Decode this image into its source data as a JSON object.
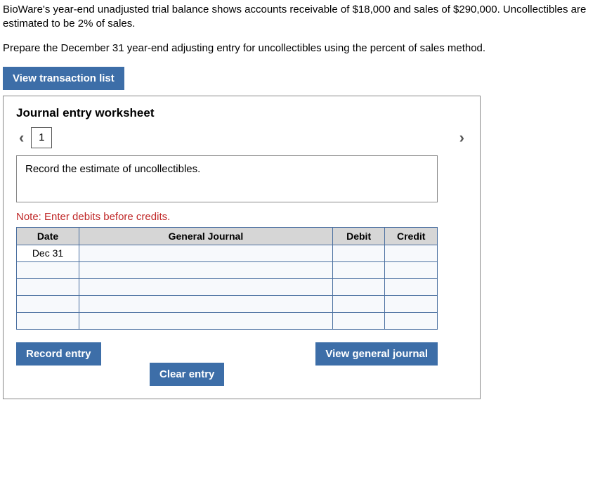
{
  "problem": {
    "p1": "BioWare's year-end unadjusted trial balance shows accounts receivable of $18,000 and sales of $290,000. Uncollectibles are estimated to be 2% of sales.",
    "p2": "Prepare the December 31 year-end adjusting entry for uncollectibles using the percent of sales method."
  },
  "buttons": {
    "view_transaction_list": "View transaction list",
    "record_entry": "Record entry",
    "clear_entry": "Clear entry",
    "view_general_journal": "View general journal"
  },
  "worksheet": {
    "title": "Journal entry worksheet",
    "page": "1",
    "instruction": "Record the estimate of uncollectibles.",
    "note": "Note: Enter debits before credits.",
    "headers": {
      "date": "Date",
      "gj": "General Journal",
      "debit": "Debit",
      "credit": "Credit"
    },
    "rows": [
      {
        "date": "Dec 31",
        "gj": "",
        "debit": "",
        "credit": ""
      },
      {
        "date": "",
        "gj": "",
        "debit": "",
        "credit": ""
      },
      {
        "date": "",
        "gj": "",
        "debit": "",
        "credit": ""
      },
      {
        "date": "",
        "gj": "",
        "debit": "",
        "credit": ""
      },
      {
        "date": "",
        "gj": "",
        "debit": "",
        "credit": ""
      }
    ]
  }
}
